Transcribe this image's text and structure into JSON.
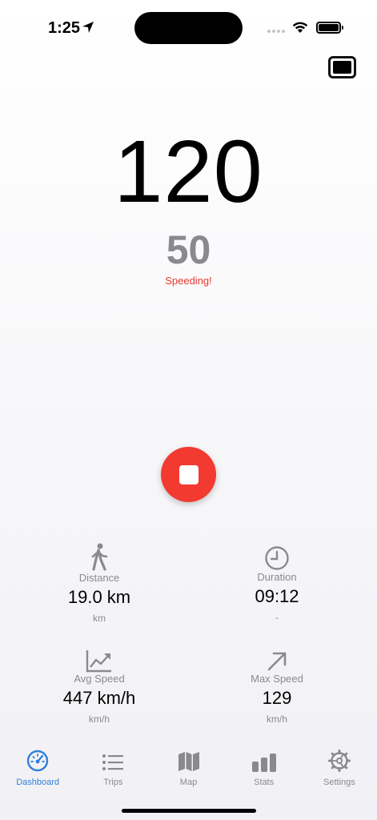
{
  "status_bar": {
    "time": "1:25"
  },
  "speedometer": {
    "current_speed": "120",
    "speed_limit": "50",
    "warning": "Speeding!"
  },
  "stats": {
    "distance": {
      "label": "Distance",
      "value": "19.0 km",
      "unit": "km"
    },
    "duration": {
      "label": "Duration",
      "value": "09:12",
      "unit": "-"
    },
    "avg_speed": {
      "label": "Avg Speed",
      "value": "447 km/h",
      "unit": "km/h"
    },
    "max_speed": {
      "label": "Max Speed",
      "value": "129",
      "unit": "km/h"
    }
  },
  "tabs": [
    {
      "label": "Dashboard",
      "icon": "speedometer-icon",
      "active": true
    },
    {
      "label": "Trips",
      "icon": "list-icon",
      "active": false
    },
    {
      "label": "Map",
      "icon": "map-icon",
      "active": false
    },
    {
      "label": "Stats",
      "icon": "bar-chart-icon",
      "active": false
    },
    {
      "label": "Settings",
      "icon": "gear-icon",
      "active": false
    }
  ],
  "colors": {
    "accent": "#2f80d8",
    "warning": "#e63a2e",
    "stop_button": "#f23a30",
    "secondary_text": "#8a8a8e"
  }
}
